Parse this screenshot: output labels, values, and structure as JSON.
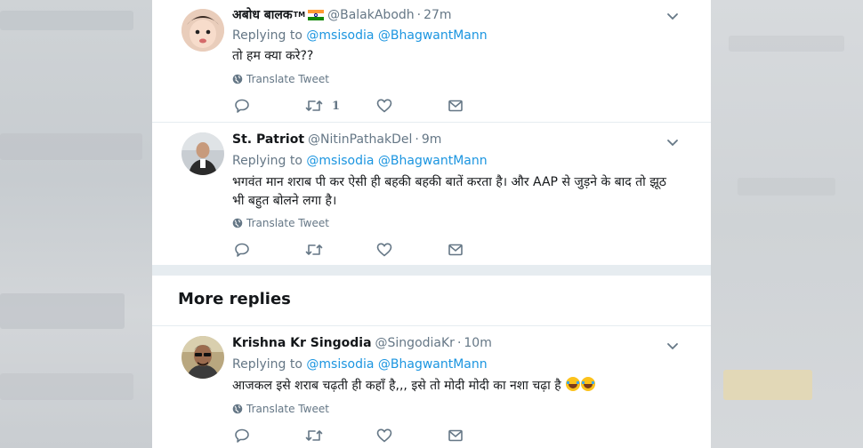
{
  "tweets": [
    {
      "name": "अबोध बालक",
      "tm": "TM",
      "handle": "@BalakAbodh",
      "time": "27m",
      "replying_prefix": "Replying to",
      "mentions": [
        "@msisodia",
        "@BhagwantMann"
      ],
      "text": "तो हम क्या करे??",
      "translate": "Translate Tweet",
      "retweet_count": "1"
    },
    {
      "name": "St. Patriot",
      "handle": "@NitinPathakDel",
      "time": "9m",
      "replying_prefix": "Replying to",
      "mentions": [
        "@msisodia",
        "@BhagwantMann"
      ],
      "text": "भगवंत मान शराब पी कर ऐसी ही बहकी बहकी बातें करता है। और AAP से जुड़ने के बाद तो झूठ भी बहुत बोलने लगा है।",
      "translate": "Translate Tweet"
    },
    {
      "name": "Krishna Kr Singodia",
      "handle": "@SingodiaKr",
      "time": "10m",
      "replying_prefix": "Replying to",
      "mentions": [
        "@msisodia",
        "@BhagwantMann"
      ],
      "text": "आजकल इसे शराब चढ़ती ही कहाँ है,,, इसे तो मोदी मोदी का नशा चढ़ा है",
      "translate": "Translate Tweet"
    }
  ],
  "section": {
    "more_replies": "More replies"
  },
  "icons": {
    "globe": "globe-icon",
    "reply": "reply-icon",
    "retweet": "retweet-icon",
    "like": "heart-icon",
    "dm": "envelope-icon",
    "caret": "chevron-down-icon",
    "emoji": "tears-of-joy-emoji"
  },
  "colors": {
    "link": "#1b95e0",
    "muted": "#657786",
    "text": "#14171a",
    "divider": "#e6ecf0"
  }
}
